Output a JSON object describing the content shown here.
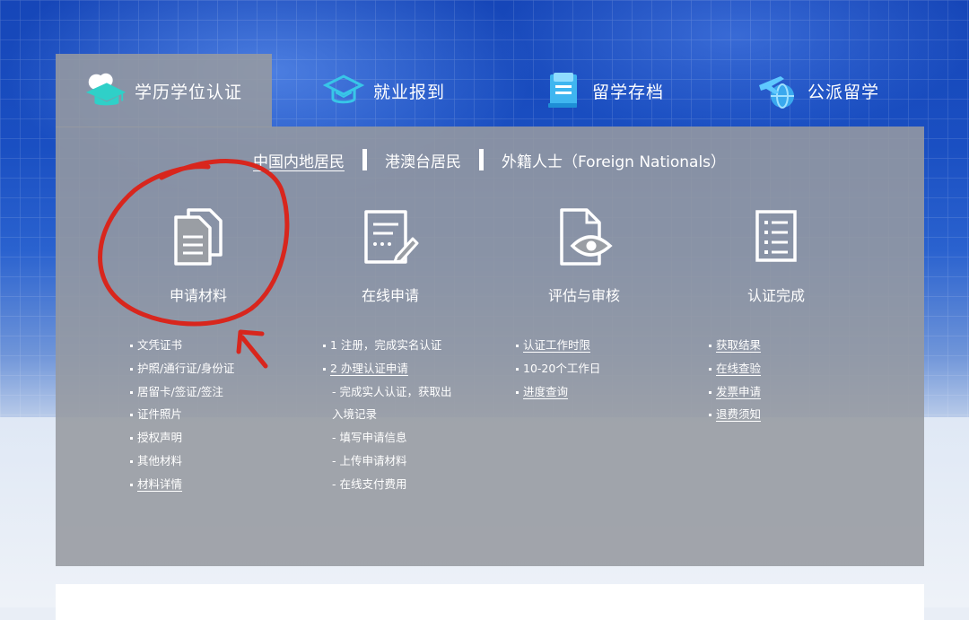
{
  "tabs": [
    {
      "label": "学历学位认证",
      "icon": "graduation-cap-icon",
      "active": true
    },
    {
      "label": "就业报到",
      "icon": "mortarboard-outline-icon",
      "active": false
    },
    {
      "label": "留学存档",
      "icon": "archive-folder-icon",
      "active": false
    },
    {
      "label": "公派留学",
      "icon": "airplane-globe-icon",
      "active": false
    }
  ],
  "subtabs": [
    {
      "label": "中国内地居民",
      "active": true
    },
    {
      "label": "港澳台居民",
      "active": false
    },
    {
      "label": "外籍人士（Foreign Nationals）",
      "active": false
    }
  ],
  "steps": [
    {
      "label": "申请材料",
      "icon": "documents-icon"
    },
    {
      "label": "在线申请",
      "icon": "form-pen-icon"
    },
    {
      "label": "评估与审核",
      "icon": "document-eye-icon"
    },
    {
      "label": "认证完成",
      "icon": "checklist-icon"
    }
  ],
  "lists": {
    "materials": [
      "文凭证书",
      "护照/通行证/身份证",
      "居留卡/签证/签注",
      "证件照片",
      "授权声明",
      "其他材料",
      "材料详情"
    ],
    "online": {
      "register": "1 注册，完成实名认证",
      "apply": "2 办理认证申请",
      "sub1a": "- 完成实人认证，获取出",
      "sub1b": "入境记录",
      "sub2": "- 填写申请信息",
      "sub3": "- 上传申请材料",
      "sub4": "- 在线支付费用"
    },
    "review": [
      "认证工作时限",
      "10-20个工作日",
      "进度查询"
    ],
    "complete": [
      "获取结果",
      "在线查验",
      "发票申请",
      "退费须知"
    ]
  },
  "colors": {
    "accent_blue": "#1a4fc2",
    "panel_gray": "#969aa0",
    "annotation_red": "#d8261d",
    "icon_teal": "#2fd0c8"
  }
}
